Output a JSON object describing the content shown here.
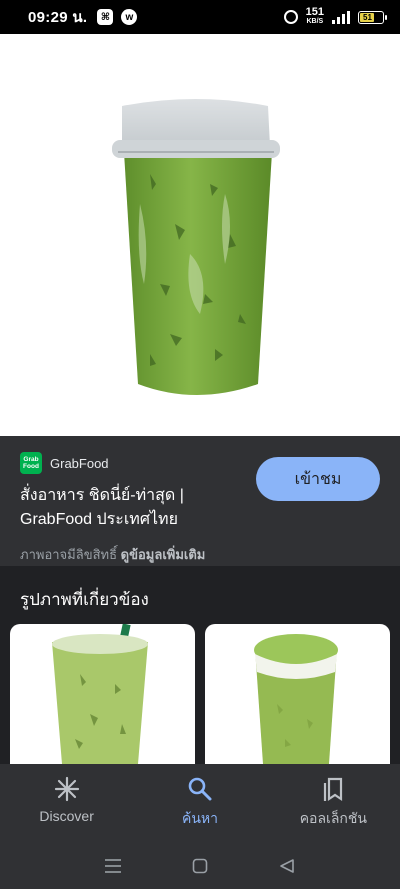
{
  "status_bar": {
    "time": "09:29 น.",
    "net_speed_value": "151",
    "net_speed_unit": "KB/S",
    "battery": "51"
  },
  "hero": {
    "image": "iced-matcha-green-tea-cup"
  },
  "info": {
    "source_name": "GrabFood",
    "logo_text_1": "Grab",
    "logo_text_2": "Food",
    "title": "สั่งอาหาร ชิดนี่ย์-ท่าสุด | GrabFood ประเทศไทย",
    "visit_label": "เข้าชม",
    "copyright_text": "ภาพอาจมีลิขสิทธิ์ ",
    "more_info_link": "ดูข้อมูลเพิ่มเติม"
  },
  "related": {
    "title": "รูปภาพที่เกี่ยวข้อง"
  },
  "bottom_nav": {
    "items": [
      {
        "label": "Discover",
        "icon": "asterisk-icon"
      },
      {
        "label": "ค้นหา",
        "icon": "search-icon"
      },
      {
        "label": "คอลเล็กชัน",
        "icon": "collections-icon"
      }
    ],
    "active_index": 1
  },
  "colors": {
    "accent": "#8ab4f8",
    "panel": "#303134",
    "background": "#202124",
    "grab_green": "#00b14f"
  }
}
